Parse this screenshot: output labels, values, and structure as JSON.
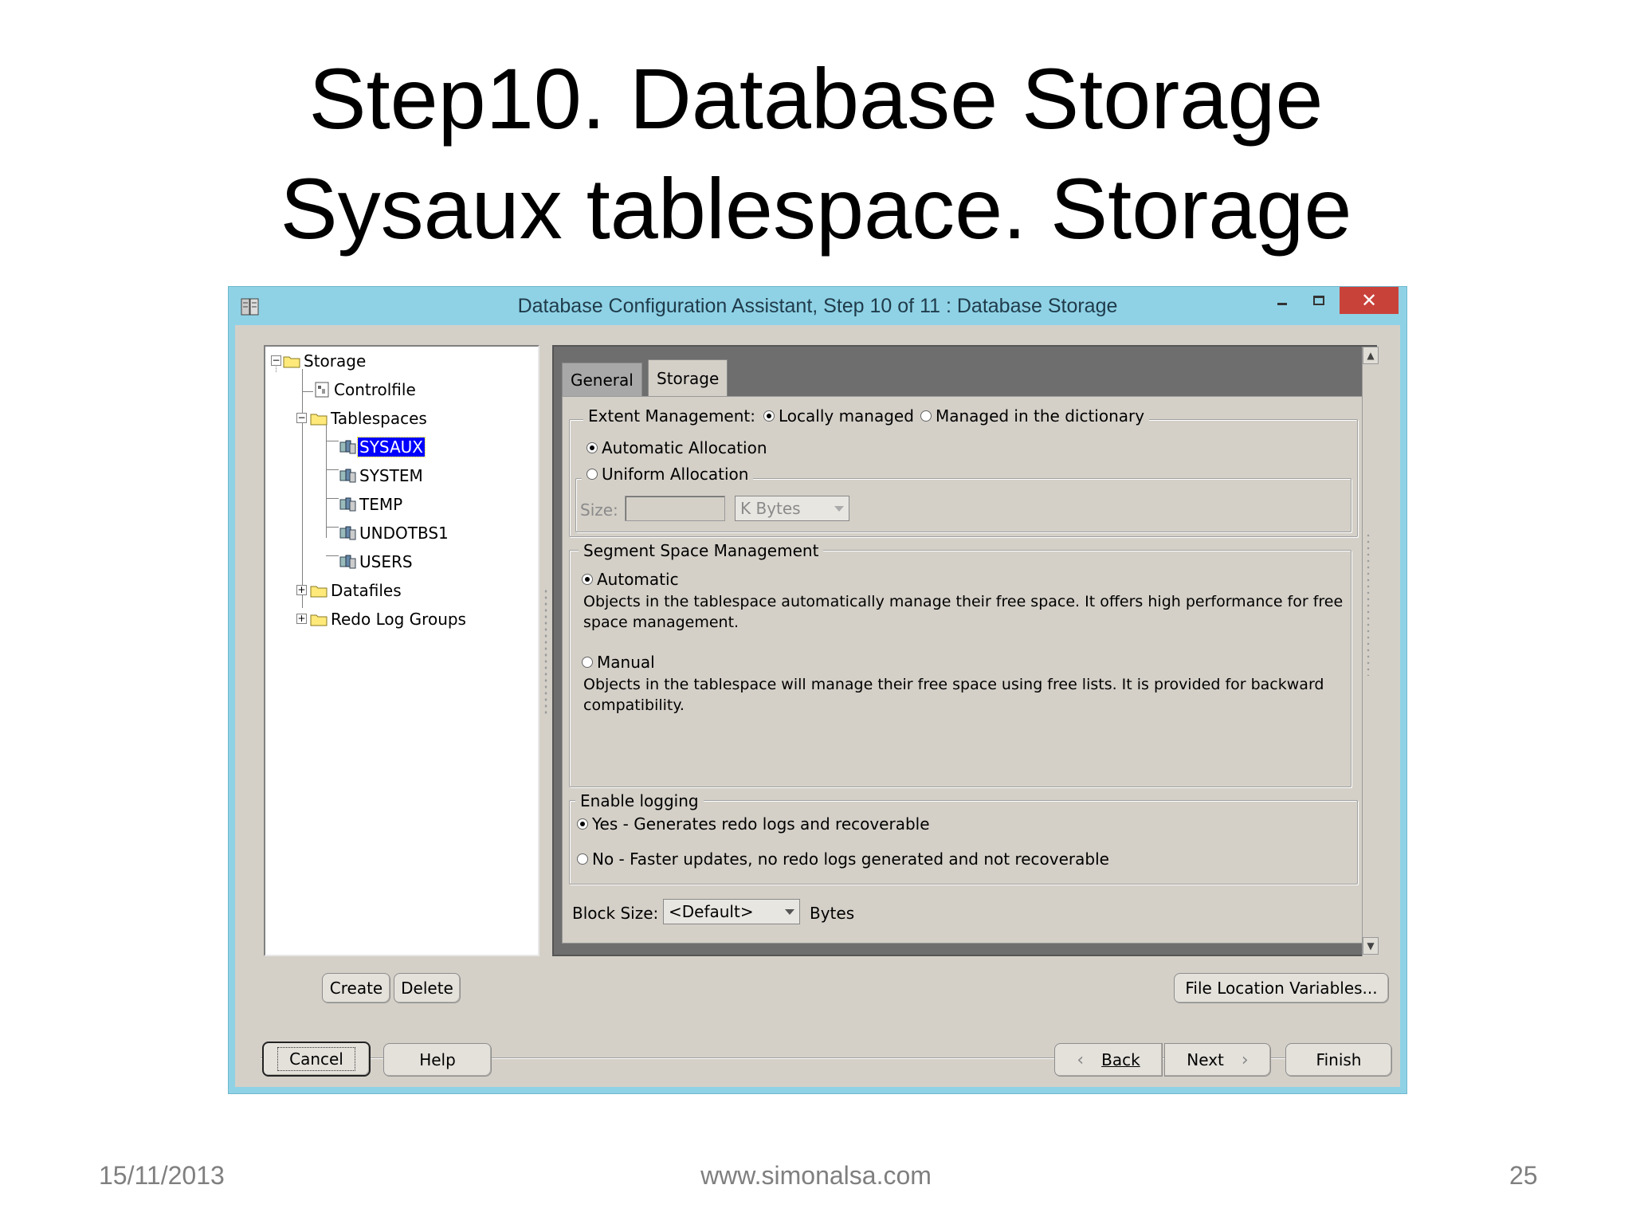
{
  "slide": {
    "title_line1": "Step10. Database Storage",
    "title_line2": "Sysaux tablespace. Storage",
    "footer_date": "15/11/2013",
    "footer_site": "www.simonalsa.com",
    "footer_page": "25"
  },
  "window": {
    "title": "Database Configuration Assistant, Step 10 of 11 : Database Storage",
    "minimize_glyph": "–",
    "maximize_glyph": "☐",
    "close_glyph": "✕"
  },
  "tree": {
    "root": "Storage",
    "controlfile": "Controlfile",
    "tablespaces": "Tablespaces",
    "tablespace_items": [
      "SYSAUX",
      "SYSTEM",
      "TEMP",
      "UNDOTBS1",
      "USERS"
    ],
    "selected": "SYSAUX",
    "datafiles": "Datafiles",
    "redo_log_groups": "Redo Log Groups"
  },
  "tabs": {
    "general": "General",
    "storage": "Storage",
    "active": "Storage"
  },
  "extent": {
    "label": "Extent Management:",
    "locally_managed": "Locally managed",
    "dictionary": "Managed in the dictionary",
    "selected": "Locally managed",
    "automatic_allocation": "Automatic Allocation",
    "uniform_allocation": "Uniform Allocation",
    "allocation_selected": "Automatic Allocation",
    "size_label": "Size:",
    "size_value": "",
    "size_unit": "K Bytes"
  },
  "segment": {
    "legend": "Segment Space Management",
    "automatic": "Automatic",
    "automatic_desc": "Objects in the tablespace automatically manage their free space. It offers high performance for free space management.",
    "manual": "Manual",
    "manual_desc": "Objects in the tablespace will manage their free space using free lists. It is provided for backward compatibility.",
    "selected": "Automatic"
  },
  "logging": {
    "legend": "Enable logging",
    "yes": "Yes - Generates redo logs and recoverable",
    "no": "No - Faster updates, no redo logs generated and not recoverable",
    "selected": "Yes"
  },
  "block_size": {
    "label": "Block Size:",
    "value": "<Default>",
    "unit": "Bytes"
  },
  "buttons": {
    "create": "Create",
    "delete": "Delete",
    "file_location_variables": "File Location Variables...",
    "cancel": "Cancel",
    "help": "Help",
    "back": "Back",
    "next": "Next",
    "finish": "Finish"
  },
  "icons": {
    "app": "database-assistant-icon",
    "folder": "folder-icon",
    "controlfile": "controlfile-icon",
    "tablespace": "tablespace-icon",
    "back": "chevron-left-icon",
    "next": "chevron-right-icon"
  },
  "colors": {
    "titlebar": "#8fd2e6",
    "close": "#c9423a",
    "selection": "#0000ff",
    "dialog": "#d4d0c8"
  }
}
